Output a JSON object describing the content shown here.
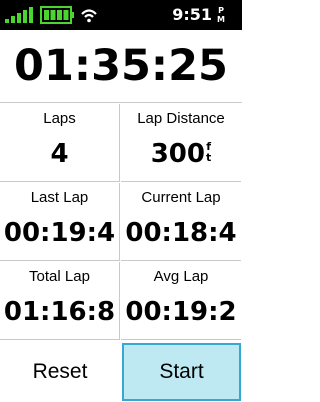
{
  "status_bar": {
    "time": "9:51",
    "ampm": "P\nM",
    "icons": [
      "signal-icon",
      "battery-icon",
      "wifi-icon"
    ],
    "colors": {
      "signal": "#4cd431",
      "battery": "#4cd431",
      "wifi": "#ffffff"
    }
  },
  "timer": {
    "value": "01:35:25"
  },
  "fields": {
    "laps": {
      "label": "Laps",
      "value": "4"
    },
    "lap_distance": {
      "label": "Lap Distance",
      "value": "300",
      "unit": "f\nt"
    },
    "last_lap": {
      "label": "Last Lap",
      "value": "00:19:4"
    },
    "current_lap": {
      "label": "Current Lap",
      "value": "00:18:4"
    },
    "total_lap": {
      "label": "Total Lap",
      "value": "01:16:8"
    },
    "avg_lap": {
      "label": "Avg Lap",
      "value": "00:19:2"
    }
  },
  "buttons": {
    "reset": "Reset",
    "start": "Start"
  },
  "colors": {
    "accent": "#35a9d1",
    "start_bg": "#bfe9f2",
    "divider": "#c9c9c9"
  }
}
